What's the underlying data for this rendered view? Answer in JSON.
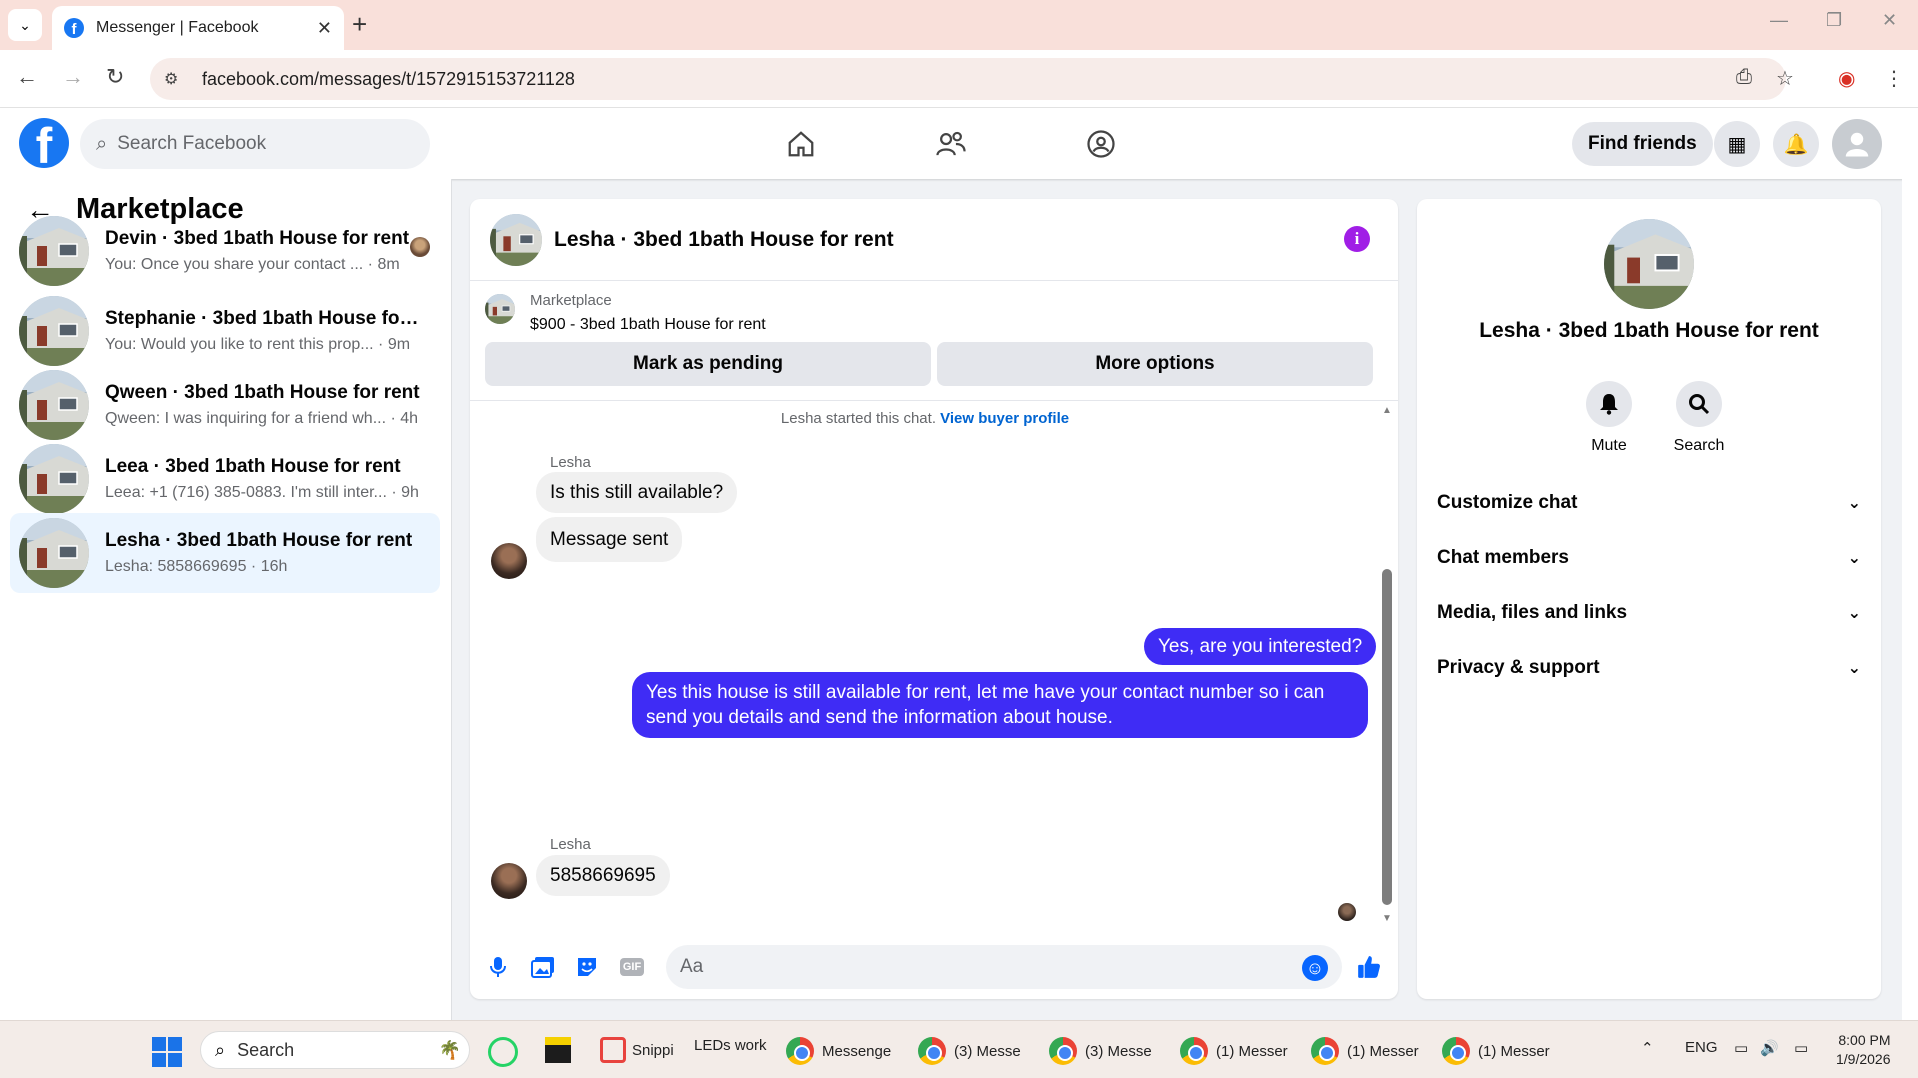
{
  "browser": {
    "tab_title": "Messenger | Facebook",
    "url": "facebook.com/messages/t/1572915153721128"
  },
  "fb": {
    "logo": "f",
    "search_placeholder": "Search Facebook",
    "find_friends": "Find friends"
  },
  "sidebar": {
    "title": "Marketplace",
    "conversations": [
      {
        "name": "Devin · 3bed 1bath House for rent",
        "preview": "You: Once you share your contact ...",
        "time": "8m",
        "active": false
      },
      {
        "name": "Stephanie · 3bed 1bath House for r...",
        "preview": "You: Would you like to rent this prop...",
        "time": "9m",
        "active": false
      },
      {
        "name": "Qween · 3bed 1bath House for rent",
        "preview": "Qween: I was inquiring for a friend wh...",
        "time": "4h",
        "active": false
      },
      {
        "name": "Leea · 3bed 1bath House for rent",
        "preview": "Leea: +1 (716) 385-0883. I'm still inter...",
        "time": "9h",
        "active": false
      },
      {
        "name": "Lesha · 3bed 1bath House for rent",
        "preview": "Lesha: 5858669695",
        "time": "16h",
        "active": true
      }
    ]
  },
  "chat": {
    "title": "Lesha · 3bed 1bath House for rent",
    "marketplace_label": "Marketplace",
    "listing": "$900 - 3bed 1bath House for rent",
    "mark_pending": "Mark as pending",
    "more_options": "More options",
    "started_note": "Lesha started this chat.",
    "view_buyer_profile": "View buyer profile",
    "messages": [
      {
        "sender": "Lesha",
        "text": "Is this still available?",
        "direction": "in"
      },
      {
        "text": "Message sent",
        "direction": "in"
      },
      {
        "text": "Yes, are you interested?",
        "direction": "out"
      },
      {
        "text": "Yes this house is still available for rent, let me have your contact number so i can send you details and send the information about house.",
        "direction": "out"
      },
      {
        "sender": "Lesha",
        "text": "5858669695",
        "direction": "in"
      }
    ],
    "composer_placeholder": "Aa",
    "gif_label": "GIF"
  },
  "info_panel": {
    "name": "Lesha · 3bed 1bath House for rent",
    "actions": [
      "Mute",
      "Search"
    ],
    "sections": [
      "Customize chat",
      "Chat members",
      "Media, files and links",
      "Privacy & support"
    ]
  },
  "taskbar": {
    "search_placeholder": "Search",
    "items": [
      "Snippi",
      "LEDs work",
      "Messenge",
      "(3) Messe",
      "(3) Messe",
      "(1) Messer",
      "(1) Messer",
      "(1) Messer"
    ],
    "language": "ENG",
    "time": "8:00 PM",
    "date": "1/9/2026"
  },
  "colors": {
    "fb_blue": "#1877f2",
    "outgoing_bubble": "#3f2cf5",
    "active_convo": "#ebf5ff",
    "tabbar": "#f9e0da"
  }
}
